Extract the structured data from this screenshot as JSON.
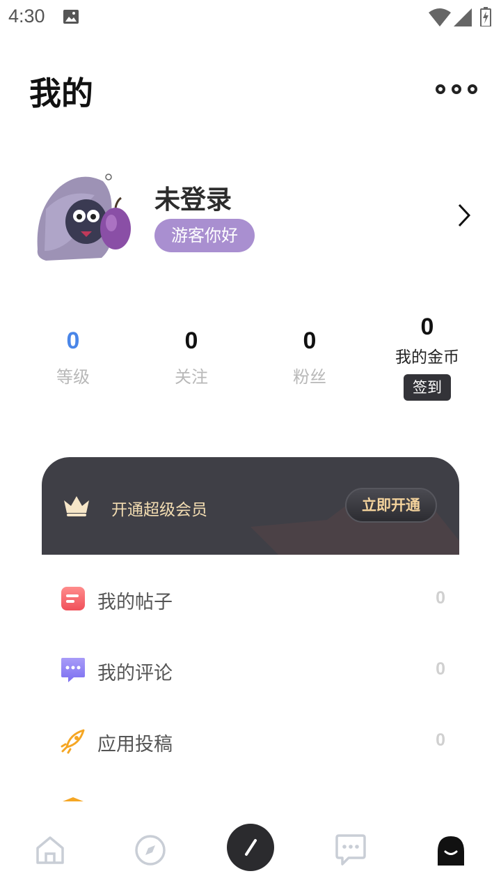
{
  "status_bar": {
    "time": "4:30"
  },
  "header": {
    "title": "我的"
  },
  "profile": {
    "username": "未登录",
    "guest_badge": "游客你好"
  },
  "stats": [
    {
      "value": "0",
      "label": "等级"
    },
    {
      "value": "0",
      "label": "关注"
    },
    {
      "value": "0",
      "label": "粉丝"
    }
  ],
  "coins": {
    "value": "0",
    "label": "我的金币",
    "signin_label": "签到"
  },
  "vip": {
    "text": "开通超级会员",
    "button_label": "立即开通"
  },
  "menu": [
    {
      "label": "我的帖子",
      "count": "0",
      "icon": "posts-icon"
    },
    {
      "label": "我的评论",
      "count": "0",
      "icon": "comment-icon"
    },
    {
      "label": "应用投稿",
      "count": "0",
      "icon": "rocket-icon"
    }
  ],
  "bottom_nav": [
    {
      "name": "home",
      "icon": "home-icon"
    },
    {
      "name": "discover",
      "icon": "compass-icon"
    },
    {
      "name": "post",
      "icon": "pen-icon"
    },
    {
      "name": "messages",
      "icon": "chat-icon"
    },
    {
      "name": "profile",
      "icon": "user-icon",
      "active": true
    }
  ],
  "colors": {
    "accent_purple": "#a98fd0",
    "level_blue": "#4a86e8",
    "vip_bg": "#3f3f46",
    "vip_gold": "#f4d39c"
  }
}
